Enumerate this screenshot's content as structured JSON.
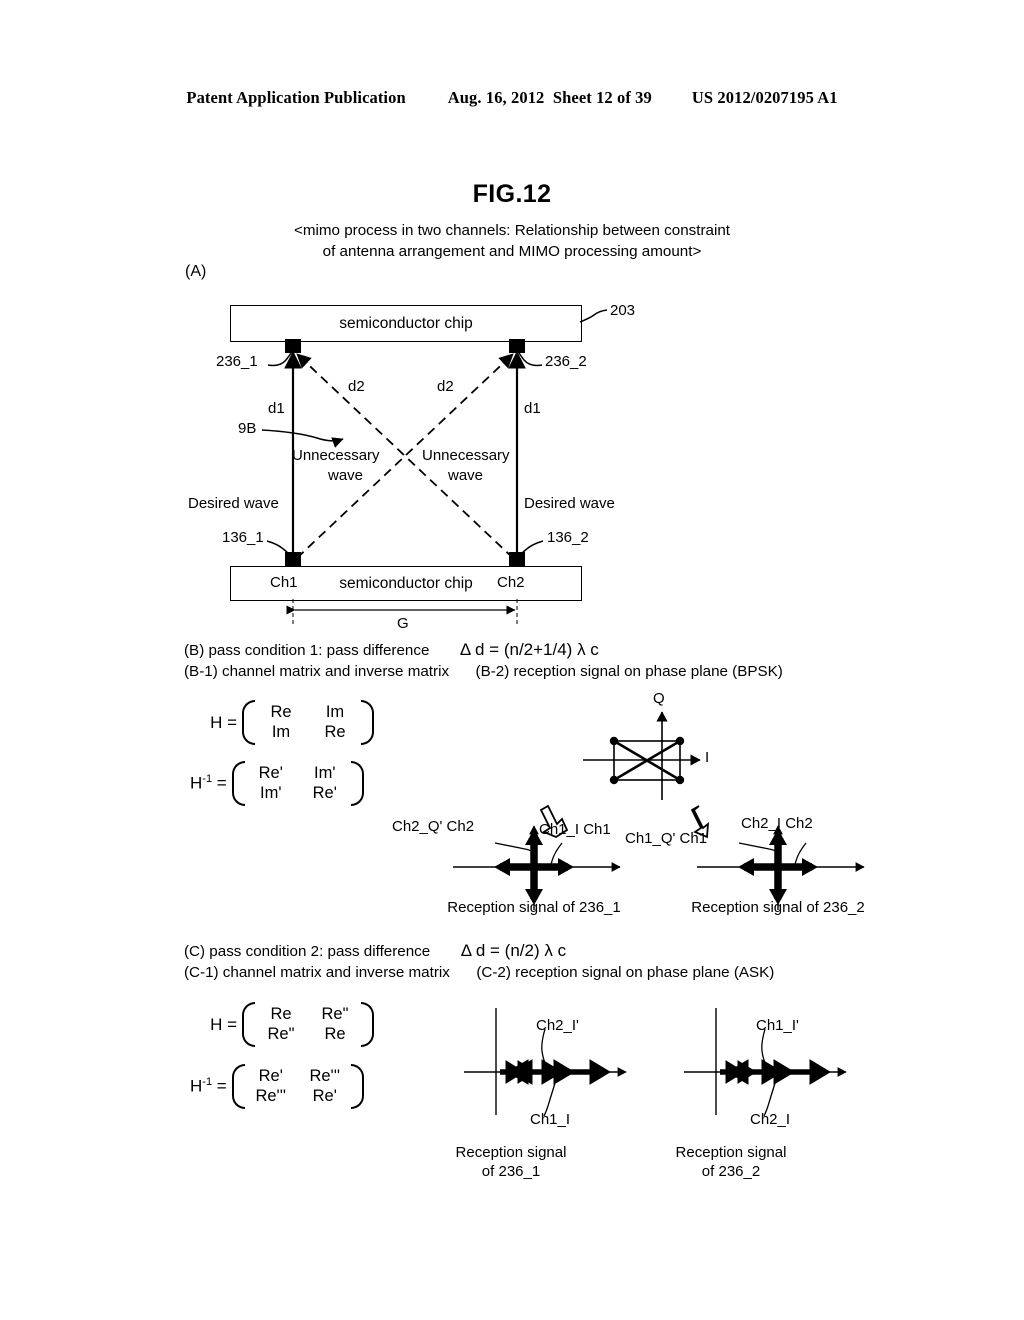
{
  "header": {
    "publication": "Patent Application Publication",
    "date": "Aug. 16, 2012",
    "sheet": "Sheet 12 of 39",
    "docnum": "US 2012/0207195 A1"
  },
  "figure": {
    "number": "FIG.12",
    "subtitle_line1": "<mimo process in two channels: Relationship between constraint",
    "subtitle_line2": "of antenna arrangement and MIMO processing amount>"
  },
  "panel_a": {
    "tag": "(A)",
    "top_chip_label": "semiconductor chip",
    "bottom_chip_label": "semiconductor chip",
    "ref_203": "203",
    "ref_236_1": "236_1",
    "ref_236_2": "236_2",
    "ref_136_1": "136_1",
    "ref_136_2": "136_2",
    "ref_9b": "9B",
    "d1_left": "d1",
    "d1_right": "d1",
    "d2_left": "d2",
    "d2_right": "d2",
    "unnecessary_left_l1": "Unnecessary",
    "unnecessary_left_l2": "wave",
    "unnecessary_right_l1": "Unnecessary",
    "unnecessary_right_l2": "wave",
    "desired_left": "Desired wave",
    "desired_right": "Desired wave",
    "ch1": "Ch1",
    "ch2": "Ch2",
    "gap_label": "G"
  },
  "panel_b": {
    "line1": "(B) pass condition 1: pass difference",
    "formula": "Δ d = (n/2+1/4) λ c",
    "line2_left": "(B-1) channel matrix and inverse matrix",
    "line2_right": "(B-2) reception signal on phase plane (BPSK)",
    "matrix_h": {
      "lead": "H =",
      "cells": [
        "Re",
        "Im",
        "Im",
        "Re"
      ]
    },
    "matrix_hinv": {
      "lead_base": "H",
      "lead_sup": "-1",
      "lead_eq": "=",
      "cells": [
        "Re'",
        "Im'",
        "Im'",
        "Re'"
      ]
    },
    "axis_q": "Q",
    "axis_i": "I",
    "left_diagram": {
      "label_q": "Ch2_Q' Ch2",
      "label_i": "Ch1_I Ch1",
      "caption": "Reception signal of 236_1"
    },
    "right_diagram": {
      "label_q": "Ch1_Q' Ch1",
      "label_i": "Ch2_I Ch2",
      "caption": "Reception signal of 236_2"
    }
  },
  "panel_c": {
    "line1": "(C) pass condition 2: pass difference",
    "formula": "Δ d = (n/2) λ c",
    "line2_left": "(C-1) channel matrix and inverse matrix",
    "line2_right": "(C-2) reception signal on phase plane (ASK)",
    "matrix_h": {
      "lead": "H =",
      "cells": [
        "Re",
        "Re\"",
        "Re\"",
        "Re"
      ]
    },
    "matrix_hinv": {
      "lead_base": "H",
      "lead_sup": "-1",
      "lead_eq": "=",
      "cells": [
        "Re'",
        "Re'''",
        "Re'''",
        "Re'"
      ]
    },
    "left_diagram": {
      "label_top": "Ch2_I'",
      "label_bottom": "Ch1_I",
      "caption_l1": "Reception signal",
      "caption_l2": "of 236_1"
    },
    "right_diagram": {
      "label_top": "Ch1_I'",
      "label_bottom": "Ch2_I",
      "caption_l1": "Reception signal",
      "caption_l2": "of 236_2"
    }
  }
}
